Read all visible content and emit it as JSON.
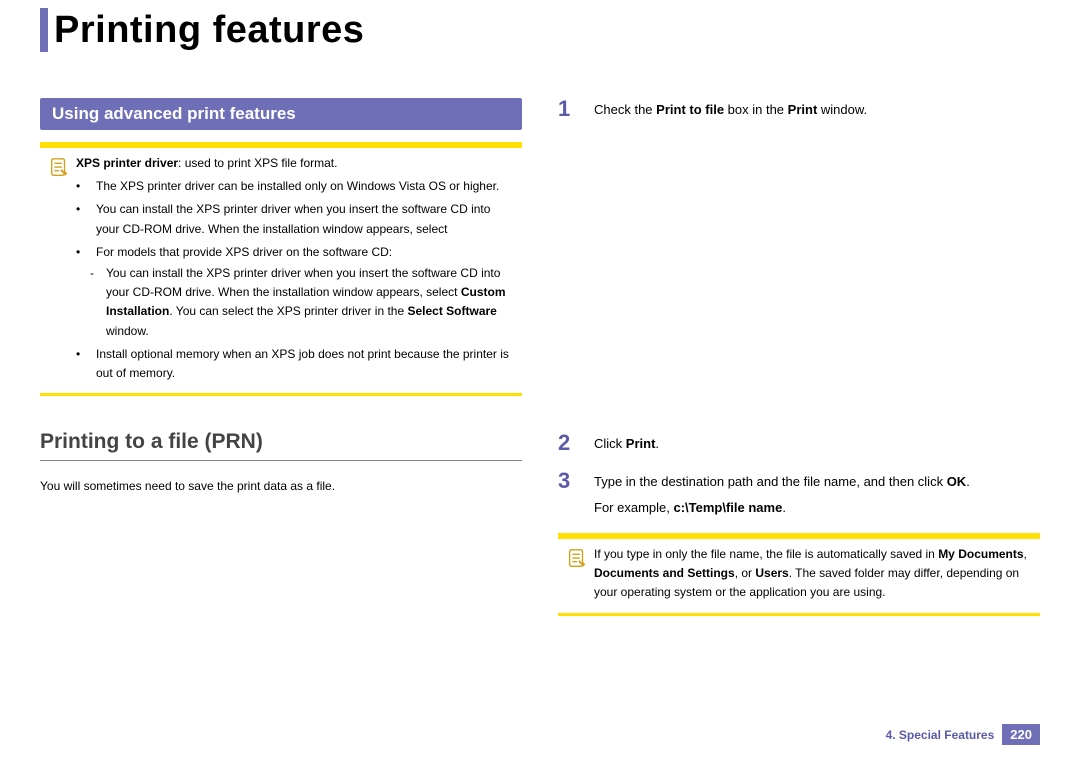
{
  "page": {
    "title": "Printing features",
    "chapter_label": "4.  Special Features",
    "page_number": "220"
  },
  "left": {
    "section_header": "Using advanced print features",
    "note": {
      "lead_bold": "XPS printer driver",
      "lead_rest": ": used to print XPS file format.",
      "bullets": [
        {
          "text": "The XPS printer driver can be installed only on Windows Vista OS or higher."
        },
        {
          "text_a": "You can install the XPS printer driver when you insert the software CD into your CD-ROM drive. When the installation window appears, select ",
          "bold_b": "Custom Installation",
          "text_c": ". You can select the XPS printer driver in the ",
          "bold_d": "Select Software",
          "text_e": " window."
        },
        {
          "text": "Install optional memory when an XPS job does not print because the printer is out of memory."
        }
      ],
      "sub_bullet": {
        "text_a": "For models that provide XPS driver on the software CD:",
        "line_b": "You can install the XPS printer driver when you insert the software CD into your CD-ROM drive. When the installation window appears, select ",
        "bold_c": "Custom Installation",
        "line_d": ". You can select the XPS printer driver in the ",
        "bold_e": "Select Software",
        "line_f": " window."
      }
    },
    "subsection_title": "Printing to a file (PRN)",
    "body_text": "You will sometimes need to save the print data as a file."
  },
  "right": {
    "steps": {
      "s1_a": "Check the ",
      "s1_b": "Print to file",
      "s1_c": " box in the ",
      "s1_d": "Print",
      "s1_e": " window.",
      "s2_a": "Click ",
      "s2_b": "Print",
      "s2_c": ".",
      "s3_a": "Type in the destination path and the file name, and then click ",
      "s3_b": "OK",
      "s3_c": ".",
      "s3_example_a": "For example, ",
      "s3_example_b": "c:\\Temp\\file name",
      "s3_example_c": "."
    },
    "note2": {
      "text_a": "If you type in only the file name, the file is automatically saved in ",
      "bold_b": "My Documents",
      "text_c": ", ",
      "bold_d": "Documents and Settings",
      "text_e": ", or ",
      "bold_f": "Users",
      "text_g": ". The saved folder may differ, depending on your operating system or the application you are using."
    }
  }
}
